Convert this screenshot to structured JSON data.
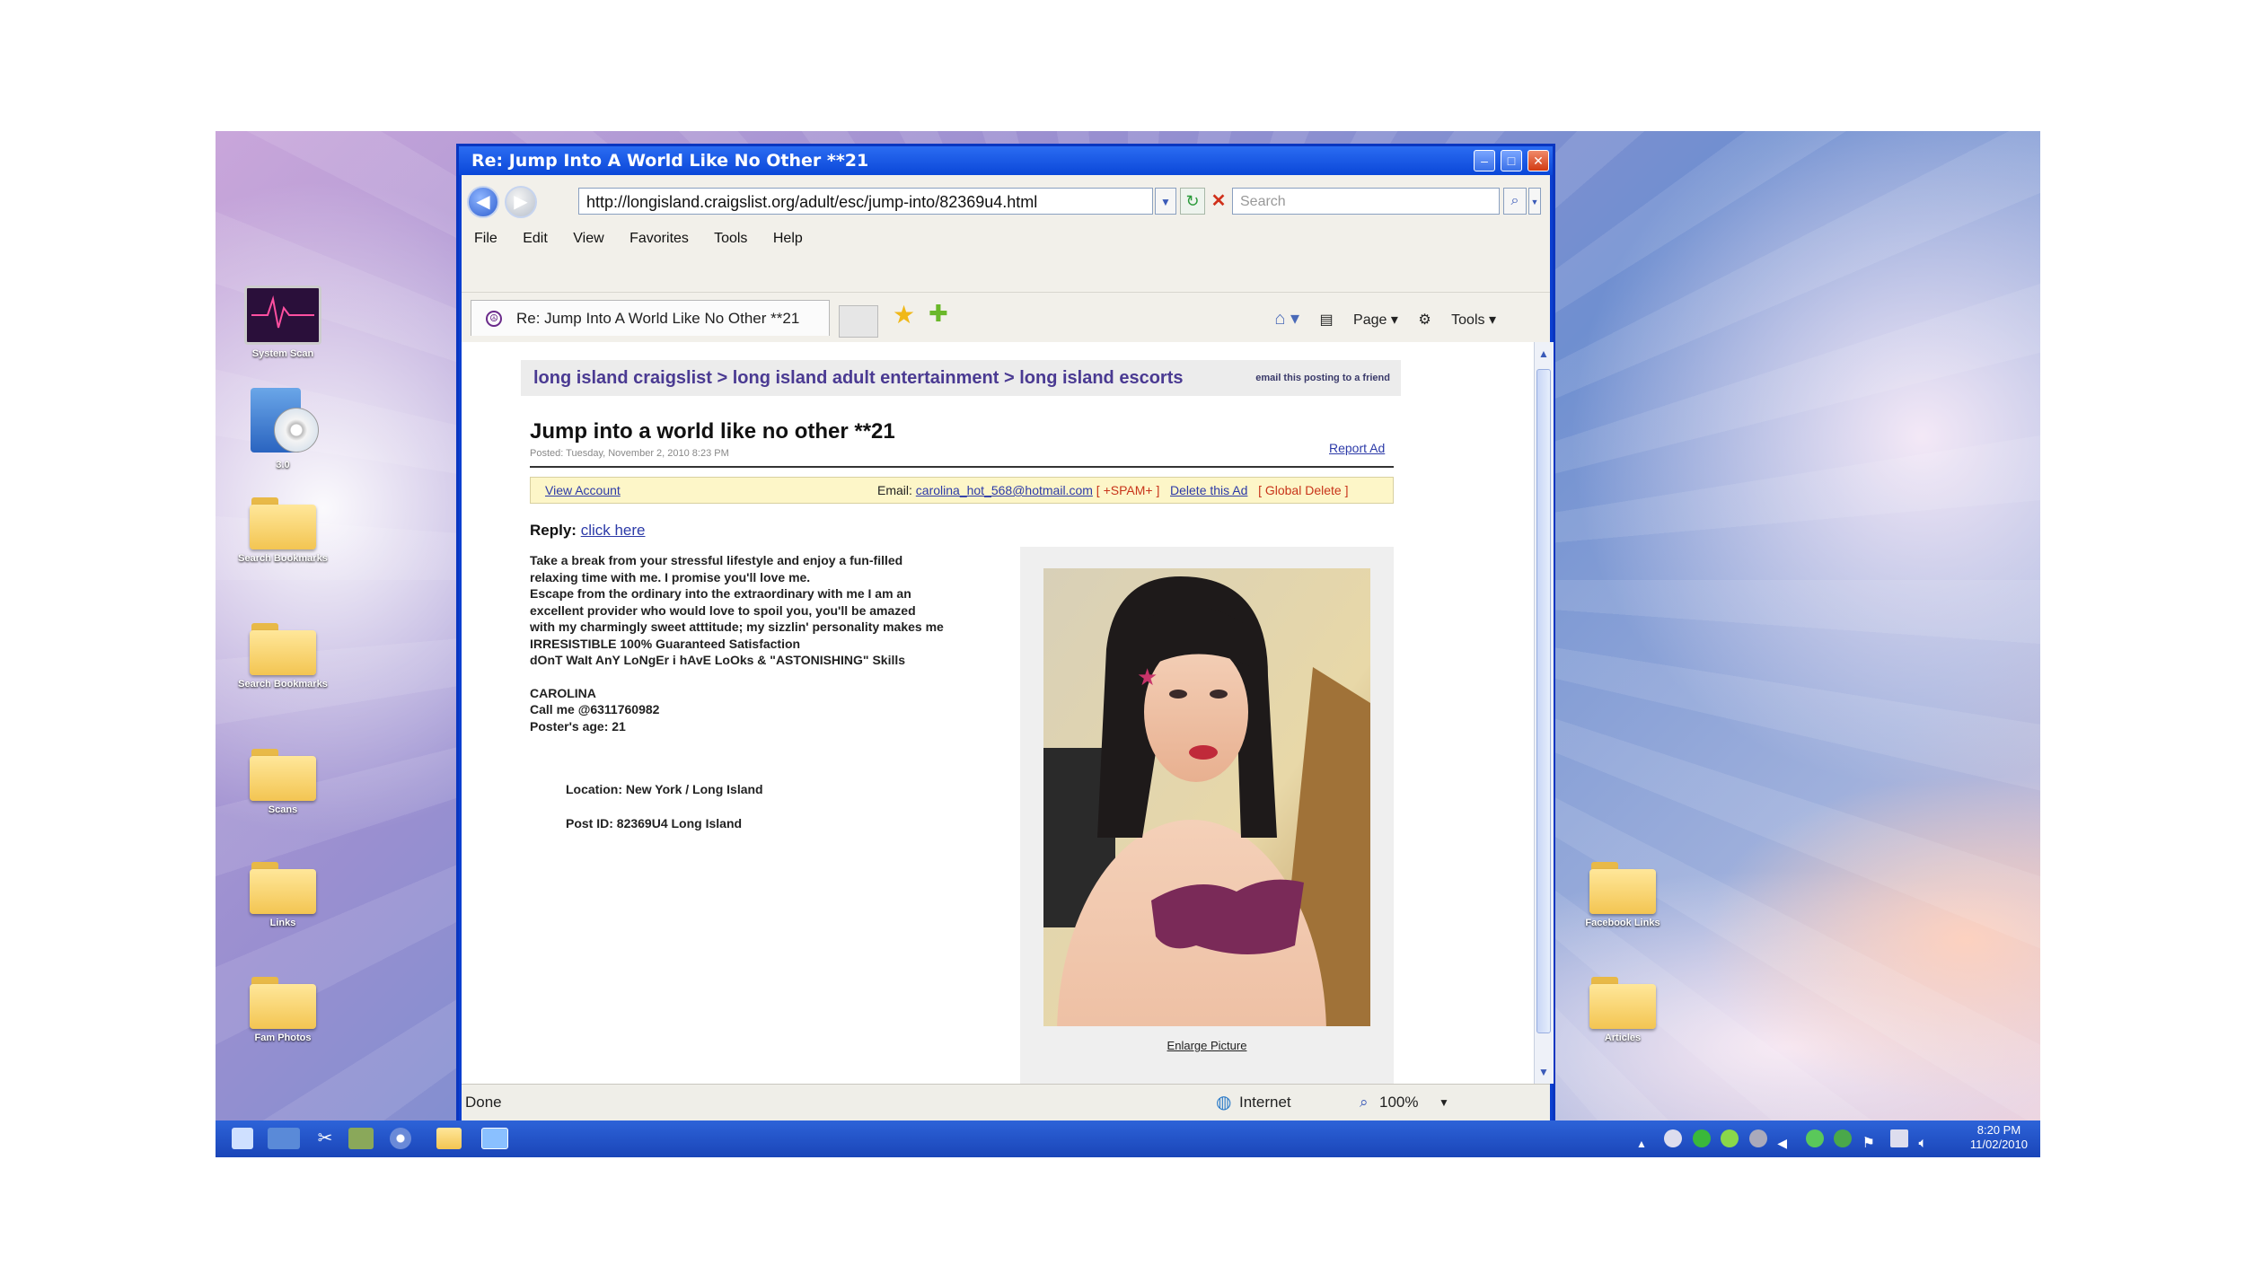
{
  "desktop": {
    "left_icons": [
      {
        "label": "System Scan",
        "kind": "app"
      },
      {
        "label": "3.0",
        "kind": "disc"
      },
      {
        "label": "Search Bookmarks",
        "kind": "folder"
      },
      {
        "label": "Search Bookmarks",
        "kind": "folder"
      },
      {
        "label": "Scans",
        "kind": "folder"
      },
      {
        "label": "Links",
        "kind": "folder"
      },
      {
        "label": "Fam Photos",
        "kind": "folder"
      }
    ],
    "right_icons": [
      {
        "label": "Facebook Links",
        "kind": "folder"
      },
      {
        "label": "Articles",
        "kind": "folder"
      }
    ]
  },
  "window": {
    "title": "Re: Jump Into A World Like No Other **21",
    "address": "http://longisland.craigslist.org/adult/esc/jump-into/82369u4.html",
    "search_placeholder": "Search",
    "menu": [
      "File",
      "Edit",
      "View",
      "Favorites",
      "Tools",
      "Help"
    ],
    "tab_title": "Re: Jump Into A World Like No Other **21",
    "right_tools": {
      "page": "Page",
      "tools": "Tools"
    },
    "status": {
      "left": "Done",
      "zone": "Internet",
      "zoom": "100%"
    }
  },
  "page": {
    "breadcrumb": "long island craigslist > long island adult entertainment > long island escorts",
    "email_friend": "email this posting to a friend",
    "title": "Jump into a world like no other **21",
    "posted": "Posted: Tuesday, November 2, 2010 8:23 PM",
    "report": "Report Ad",
    "account": {
      "view": "View Account",
      "email_label": "Email:",
      "email": "carolina_hot_568@hotmail.com",
      "spam": "[ +SPAM+ ]",
      "delete": "Delete this Ad",
      "global_delete": "[ Global Delete ]"
    },
    "reply_label": "Reply:",
    "reply_link": "click here",
    "body_lines": [
      "Take a break from your stressful lifestyle and enjoy a fun-filled",
      "relaxing time with me. I promise you'll love me.",
      "Escape from the ordinary into the extraordinary with me I am an",
      "excellent provider who would love to spoil you, you'll be amazed",
      "with my charmingly sweet atttitude; my sizzlin' personality makes me",
      "IRRESISTIBLE 100% Guaranteed Satisfaction",
      "dOnT WaIt AnY LoNgEr i hAvE LoOks & \"ASTONISHING\" Skills"
    ],
    "signature": [
      "CAROLINA",
      "Call me @6311760982",
      "Poster's age: 21"
    ],
    "location": "Location: New York / Long Island",
    "post_id": "Post ID: 82369U4 Long Island",
    "enlarge": "Enlarge Picture"
  },
  "taskbar": {
    "time": "8:20 PM",
    "date": "11/02/2010"
  },
  "colors": {
    "link": "#2c3aa8",
    "crumb": "#4a3a92",
    "titlebar": "#0a47d8"
  }
}
